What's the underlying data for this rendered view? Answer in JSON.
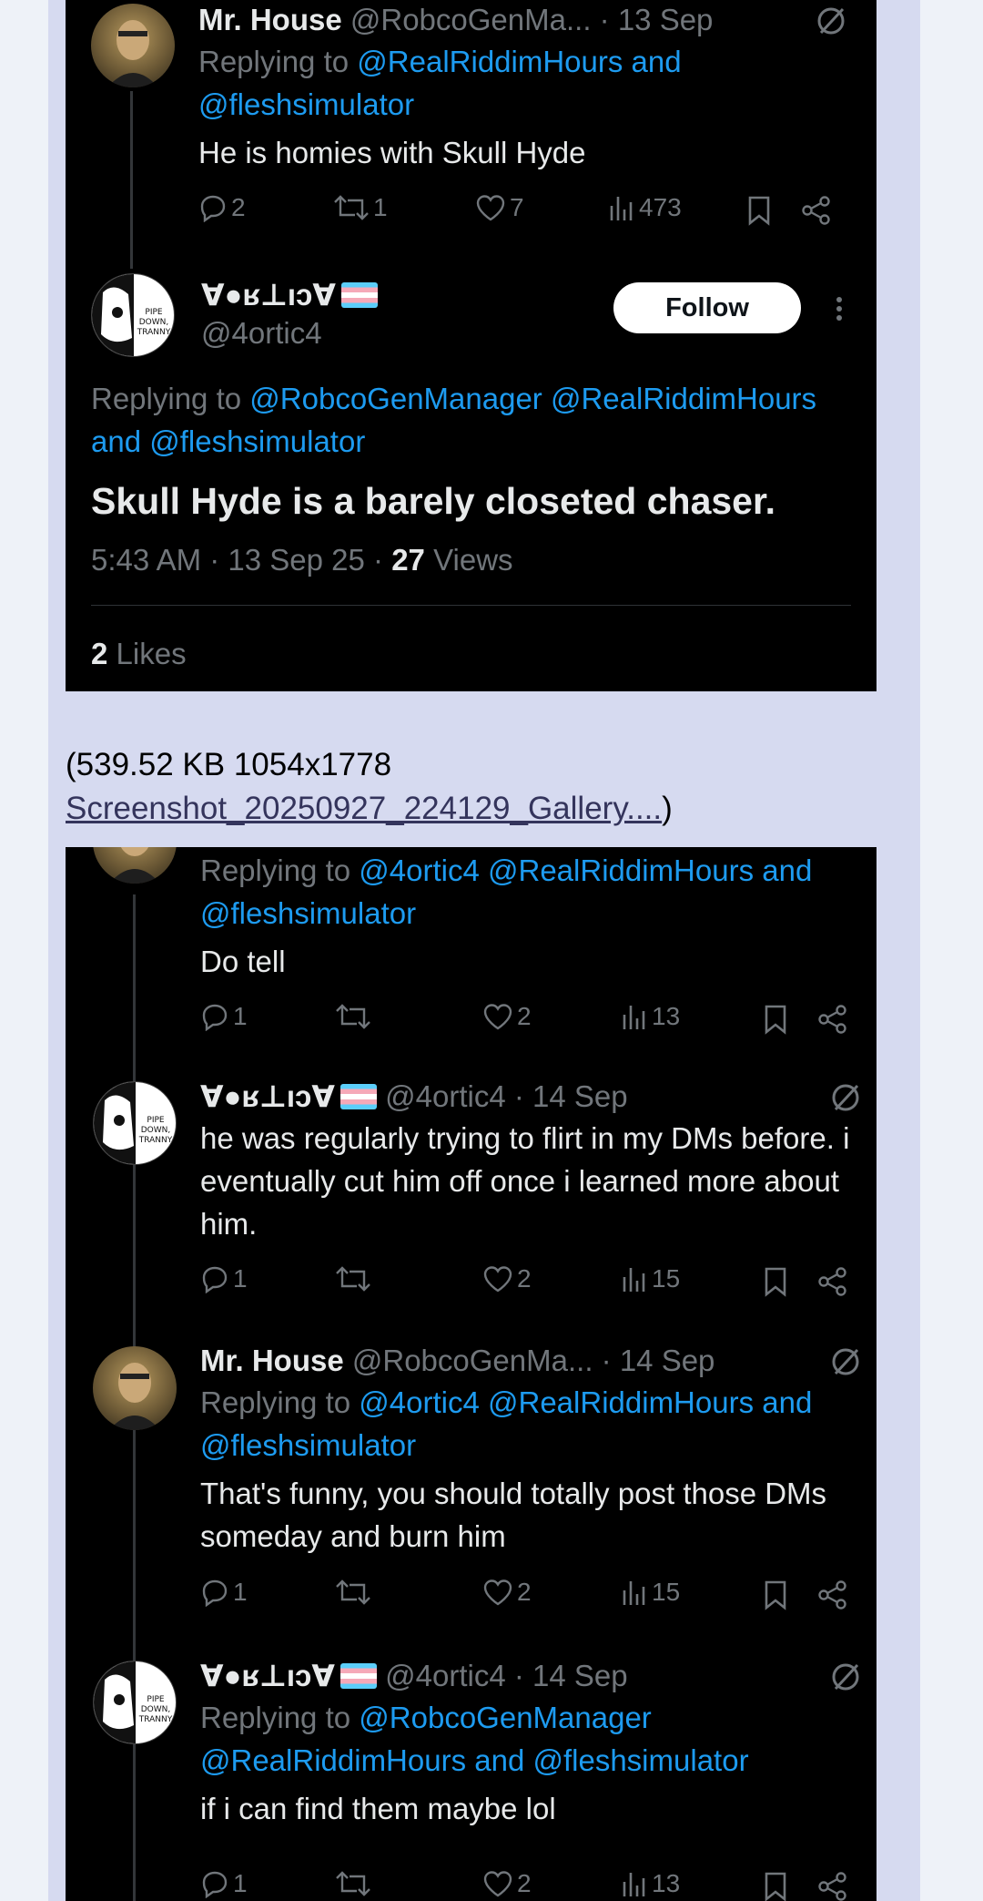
{
  "shot1": {
    "tweet_a": {
      "name": "Mr. House",
      "handle_time": "@RobcoGenMa... · 13 Sep",
      "replying_prefix": "Replying to",
      "replying_links_1": "@RealRiddimHours and",
      "replying_links_2": "@fleshsimulator",
      "text": "He is homies with Skull Hyde",
      "replies": "2",
      "retweets": "1",
      "likes": "7",
      "views": "473"
    },
    "main_tweet": {
      "name": "Ɐ●ʁ⊥ıɔⱯ",
      "handle": "@4ortic4",
      "follow_label": "Follow",
      "replying_prefix": "Replying to",
      "replying_line1_links": "@RobcoGenManager @RealRiddimHours",
      "replying_line2_links": "and @fleshsimulator",
      "text": "Skull Hyde is a barely closeted chaser.",
      "meta_time": "5:43 AM · 13 Sep 25 · ",
      "meta_views_count": "27",
      "meta_views_label": " Views",
      "likes_count": "2",
      "likes_label": " Likes"
    }
  },
  "caption": {
    "size": "(539.52 KB 1054x1778",
    "link_text": "Screenshot_20250927_224129_Gallery....",
    "close": ")"
  },
  "shot2": {
    "t1": {
      "replying_prefix": "Replying to",
      "replying_links_1": "@4ortic4 @RealRiddimHours and",
      "replying_links_2": "@fleshsimulator",
      "text": "Do tell",
      "replies": "1",
      "retweets": "",
      "likes": "2",
      "views": "13"
    },
    "t2": {
      "name": "Ɐ●ʁ⊥ıɔⱯ",
      "handle_time": "@4ortic4 · 14 Sep",
      "text": "he was regularly trying to flirt in my DMs before. i eventually cut him off once i learned more about him.",
      "replies": "1",
      "likes": "2",
      "views": "15"
    },
    "t3": {
      "name": "Mr. House",
      "handle_time": "@RobcoGenMa... · 14 Sep",
      "replying_prefix": "Replying to",
      "replying_links_1": "@4ortic4 @RealRiddimHours and",
      "replying_links_2": "@fleshsimulator",
      "text": "That's funny, you should totally post those DMs someday and burn him",
      "replies": "1",
      "likes": "2",
      "views": "15"
    },
    "t4": {
      "name": "Ɐ●ʁ⊥ıɔⱯ",
      "handle_time": "@4ortic4 · 14 Sep",
      "replying_prefix": "Replying to",
      "replying_links_1": "@RobcoGenManager",
      "replying_links_2": "@RealRiddimHours and @fleshsimulator",
      "text": "if i can find them maybe lol",
      "replies": "1",
      "likes": "2",
      "views": "13"
    }
  },
  "avatar_text": "PIPE DOWN, TRANNY",
  "colors": {
    "link": "#1d9bf0",
    "muted": "#71767b",
    "text": "#e7e9ea",
    "bg": "#000000",
    "page": "#d6daf0"
  },
  "icons": [
    "reply-icon",
    "retweet-icon",
    "like-icon",
    "views-icon",
    "bookmark-icon",
    "share-icon",
    "grok-icon",
    "more-icon"
  ]
}
